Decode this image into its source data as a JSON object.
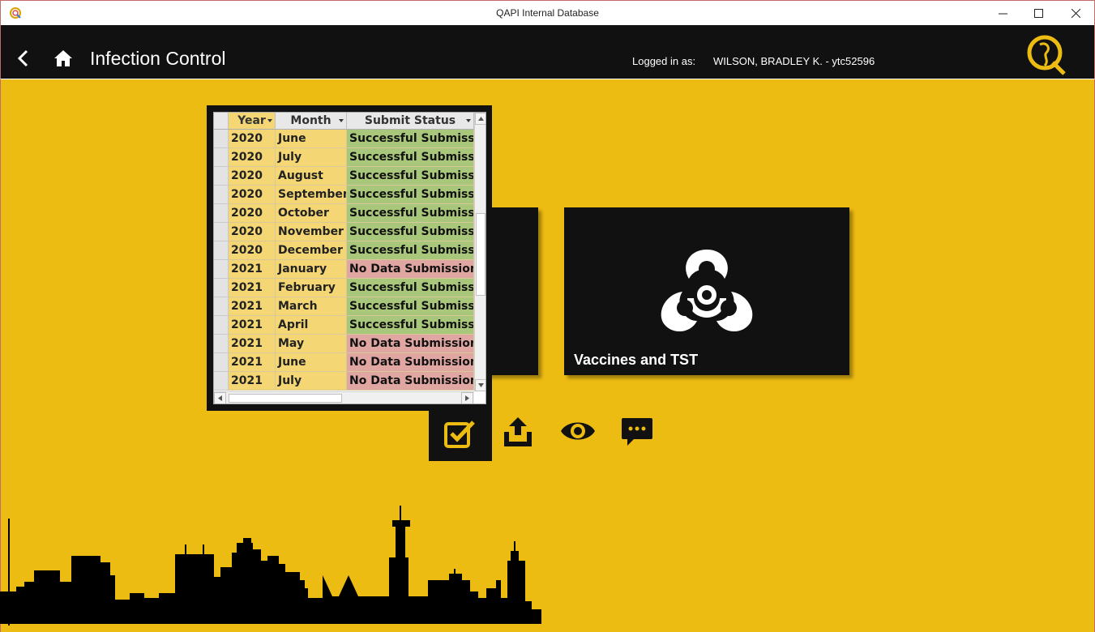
{
  "window": {
    "title": "QAPI Internal Database",
    "icon": "q-app-icon",
    "controls": [
      "minimize-icon",
      "maximize-icon",
      "close-icon"
    ]
  },
  "header": {
    "page_title": "Infection Control",
    "login_label": "Logged in as:",
    "login_user": "WILSON, BRADLEY K. - ytc52596",
    "back_icon": "chevron-left-icon",
    "home_icon": "home-icon",
    "logo": "qapi-logo"
  },
  "grid": {
    "columns": [
      "Year",
      "Month",
      "Submit Status"
    ],
    "rows": [
      {
        "year": "2020",
        "month": "June",
        "status": "Successful Submission",
        "ok": true
      },
      {
        "year": "2020",
        "month": "July",
        "status": "Successful Submission",
        "ok": true
      },
      {
        "year": "2020",
        "month": "August",
        "status": "Successful Submission",
        "ok": true
      },
      {
        "year": "2020",
        "month": "September",
        "status": "Successful Submission",
        "ok": true
      },
      {
        "year": "2020",
        "month": "October",
        "status": "Successful Submission",
        "ok": true
      },
      {
        "year": "2020",
        "month": "November",
        "status": "Successful Submission",
        "ok": true
      },
      {
        "year": "2020",
        "month": "December",
        "status": "Successful Submission",
        "ok": true
      },
      {
        "year": "2021",
        "month": "January",
        "status": "No Data Submission",
        "ok": false
      },
      {
        "year": "2021",
        "month": "February",
        "status": "Successful Submission",
        "ok": true
      },
      {
        "year": "2021",
        "month": "March",
        "status": "Successful Submission",
        "ok": true
      },
      {
        "year": "2021",
        "month": "April",
        "status": "Successful Submission",
        "ok": true
      },
      {
        "year": "2021",
        "month": "May",
        "status": "No Data Submission",
        "ok": false
      },
      {
        "year": "2021",
        "month": "June",
        "status": "No Data Submission",
        "ok": false
      },
      {
        "year": "2021",
        "month": "July",
        "status": "No Data Submission",
        "ok": false
      }
    ]
  },
  "tiles": {
    "vaccines": {
      "label": "Vaccines and TST",
      "icon": "biohazard-icon"
    }
  },
  "actions": [
    {
      "name": "checkbox-icon",
      "active": true
    },
    {
      "name": "upload-tray-icon",
      "active": false
    },
    {
      "name": "eye-icon",
      "active": false
    },
    {
      "name": "chat-bubble-icon",
      "active": false
    }
  ],
  "colors": {
    "accent": "#edbc12",
    "header_bg": "#111111",
    "success": "#a9c77b",
    "no_data": "#e0a6a2",
    "cell_yellow": "#f4d774"
  }
}
